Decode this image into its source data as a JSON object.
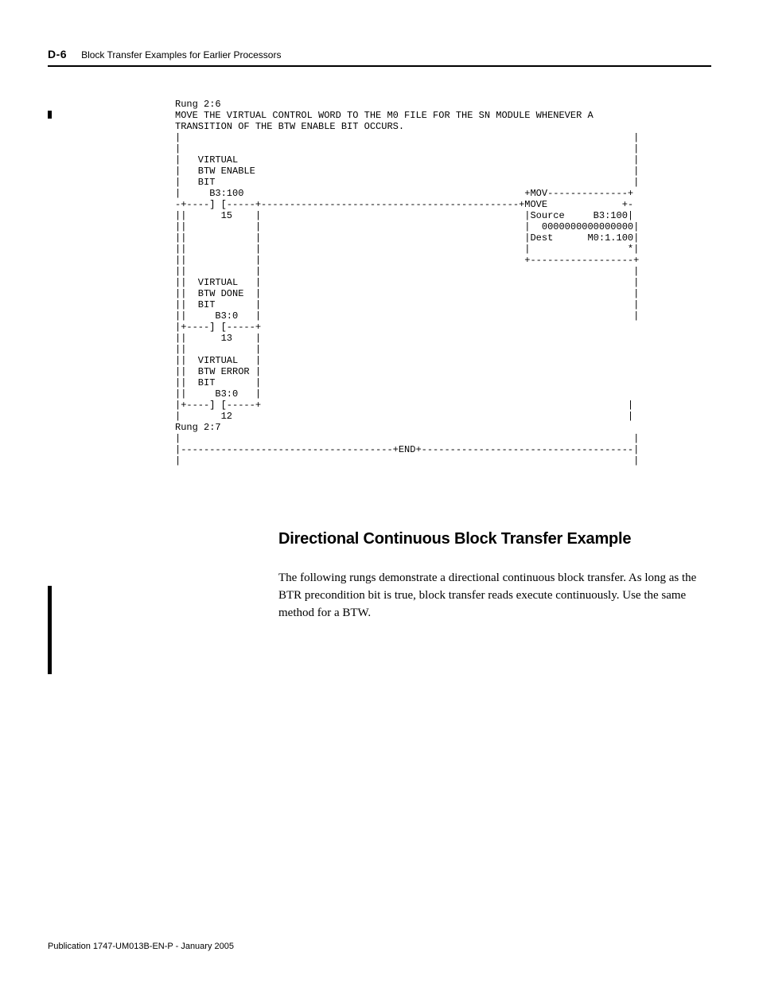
{
  "header": {
    "page_number": "D-6",
    "chapter_title": "Block Transfer Examples for Earlier Processors"
  },
  "ladder": "Rung 2:6\nMOVE THE VIRTUAL CONTROL WORD TO THE M0 FILE FOR THE SN MODULE WHENEVER A\nTRANSITION OF THE BTW ENABLE BIT OCCURS.\n|                                                                               |\n|                                                                               |\n|   VIRTUAL                                                                     |\n|   BTW ENABLE                                                                  |\n|   BIT                                                                         |\n|     B3:100                                                 +MOV--------------+\n-+----] [-----+---------------------------------------------+MOVE             +-\n||      15    |                                              |Source     B3:100|\n||            |                                              |  0000000000000000|\n||            |                                              |Dest      M0:1.100|\n||            |                                              |                 *|\n||            |                                              +------------------+\n||            |                                                                 |\n||  VIRTUAL   |                                                                 |\n||  BTW DONE  |                                                                 |\n||  BIT       |                                                                 |\n||     B3:0   |                                                                 |\n|+----] [-----+                                                                 \n||      13    |                                                                 \n||            |                                                                 \n||  VIRTUAL   |                                                                 \n||  BTW ERROR |                                                                 \n||  BIT       |                                                                 \n||     B3:0   |                                                                 \n|+----] [-----+                                                                |\n|       12                                                                     |\nRung 2:7\n|                                                                               |\n|-------------------------------------+END+-------------------------------------|\n|                                                                               |",
  "section": {
    "heading": "Directional Continuous Block Transfer Example",
    "body": "The following rungs demonstrate a directional continuous block transfer. As long as the BTR precondition bit is true, block transfer reads execute continuously. Use the same method for a BTW."
  },
  "footer": {
    "pub": "Publication 1747-UM013B-EN-P - January 2005"
  }
}
